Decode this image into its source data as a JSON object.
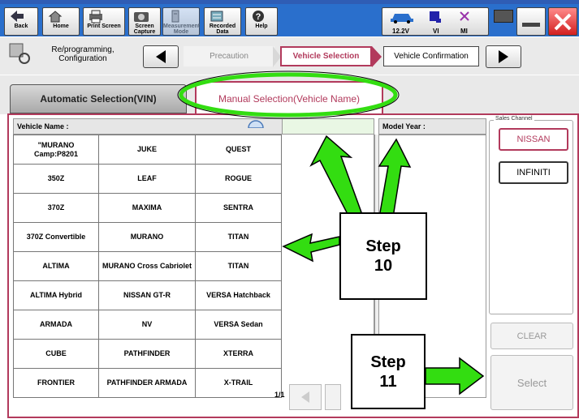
{
  "toolbar": {
    "buttons": [
      {
        "label": "Back",
        "icon": "back-arrow-icon"
      },
      {
        "label": "Home",
        "icon": "home-icon"
      },
      {
        "label": "Print Screen",
        "icon": "printer-icon"
      },
      {
        "label": "Screen Capture",
        "icon": "camera-icon"
      },
      {
        "label": "Measurement Mode",
        "icon": "gauge-icon"
      },
      {
        "label": "Recorded Data",
        "icon": "recorded-data-icon"
      },
      {
        "label": "Help",
        "icon": "help-icon"
      }
    ],
    "battery_voltage": "12.2V",
    "vi_label": "VI",
    "mi_label": "MI"
  },
  "breadcrumb": {
    "section": "Re/programming,\nConfiguration",
    "steps": [
      "Precaution",
      "Vehicle Selection",
      "Vehicle Confirmation"
    ],
    "active_step": "Vehicle Selection"
  },
  "tabs": {
    "automatic": "Automatic Selection(VIN)",
    "manual": "Manual Selection(Vehicle Name)"
  },
  "table": {
    "vehicle_name_header": "Vehicle Name :",
    "model_year_header": "Model Year :",
    "rows": [
      [
        "\"MURANO Camp:P8201",
        "JUKE",
        "QUEST"
      ],
      [
        "350Z",
        "LEAF",
        "ROGUE"
      ],
      [
        "370Z",
        "MAXIMA",
        "SENTRA"
      ],
      [
        "370Z Convertible",
        "MURANO",
        "TITAN"
      ],
      [
        "ALTIMA",
        "MURANO Cross Cabriolet",
        "TITAN"
      ],
      [
        "ALTIMA Hybrid",
        "NISSAN GT-R",
        "VERSA Hatchback"
      ],
      [
        "ARMADA",
        "NV",
        "VERSA Sedan"
      ],
      [
        "CUBE",
        "PATHFINDER",
        "XTERRA"
      ],
      [
        "FRONTIER",
        "PATHFINDER ARMADA",
        "X-TRAIL"
      ]
    ],
    "page_indicator": "1/1"
  },
  "sales_channel": {
    "label": "Sales Channel",
    "options": [
      "NISSAN",
      "INFINITI"
    ]
  },
  "actions": {
    "clear": "CLEAR",
    "select": "Select"
  },
  "annotations": {
    "step10": "Step\n10",
    "step11": "Step\n11"
  },
  "colors": {
    "toolbar_blue": "#2a6fcc",
    "accent_red": "#b23a5c",
    "callout_green": "#33dd11"
  }
}
